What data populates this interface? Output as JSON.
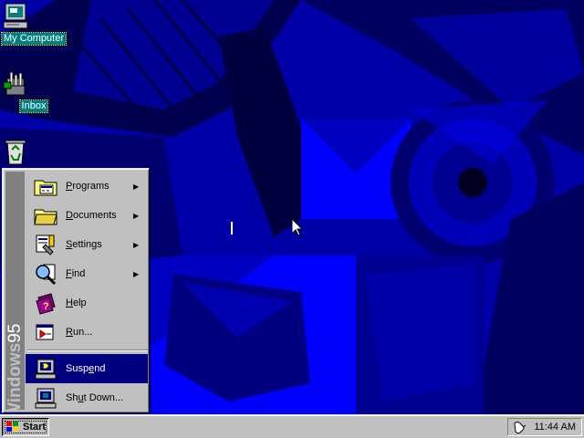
{
  "desktop": {
    "icons": [
      {
        "label": "My Computer",
        "icon": "my-computer-icon",
        "selected": true
      },
      {
        "label": "Inbox",
        "icon": "inbox-icon",
        "selected": true
      },
      {
        "label": "Recycle Bin",
        "icon": "recycle-bin-icon",
        "selected": false
      }
    ],
    "wallpaper_color": "#0000a8"
  },
  "start_menu": {
    "banner_bold": "Windows",
    "banner_light": "95",
    "items": [
      {
        "pre": "",
        "ul": "P",
        "post": "rograms",
        "icon": "programs-icon",
        "submenu": true
      },
      {
        "pre": "",
        "ul": "D",
        "post": "ocuments",
        "icon": "documents-icon",
        "submenu": true
      },
      {
        "pre": "",
        "ul": "S",
        "post": "ettings",
        "icon": "settings-icon",
        "submenu": true
      },
      {
        "pre": "",
        "ul": "F",
        "post": "ind",
        "icon": "find-icon",
        "submenu": true
      },
      {
        "pre": "",
        "ul": "H",
        "post": "elp",
        "icon": "help-icon",
        "submenu": false
      },
      {
        "pre": "",
        "ul": "R",
        "post": "un...",
        "icon": "run-icon",
        "submenu": false
      },
      {
        "pre": "Susp",
        "ul": "e",
        "post": "nd",
        "icon": "suspend-icon",
        "submenu": false,
        "highlighted": true
      },
      {
        "pre": "Sh",
        "ul": "u",
        "post": "t Down...",
        "icon": "shut-down-icon",
        "submenu": false
      }
    ],
    "submenu_arrow": "▶",
    "highlight_color": "#000080"
  },
  "taskbar": {
    "start_label": "Start",
    "clock": "11:44 AM"
  }
}
